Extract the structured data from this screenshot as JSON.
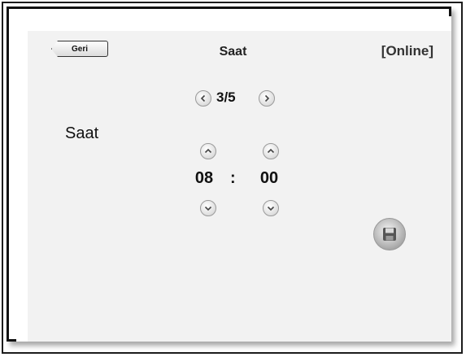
{
  "header": {
    "back_label": "Geri",
    "title": "Saat",
    "status": "[Online]"
  },
  "pager": {
    "indicator": "3/5"
  },
  "setting": {
    "label": "Saat"
  },
  "time": {
    "hours": "08",
    "separator": ":",
    "minutes": "00"
  },
  "icons": {
    "prev": "chevron-left-icon",
    "next": "chevron-right-icon",
    "up": "chevron-up-icon",
    "down": "chevron-down-icon",
    "save": "floppy-disk-icon"
  }
}
